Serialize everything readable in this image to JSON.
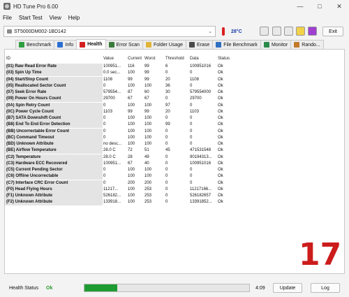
{
  "window": {
    "title": "HD Tune Pro 6.00",
    "minimize_icon": "minimize-icon",
    "maximize_icon": "maximize-icon",
    "close_icon": "close-icon"
  },
  "menu": [
    "File",
    "Start Test",
    "View",
    "Help"
  ],
  "toolbar": {
    "drive": "ST5000DM002-1BD142",
    "temperature": "28°C",
    "exit_label": "Exit",
    "icons": [
      "copy-text-icon",
      "copy-screenshot-icon",
      "save-icon",
      "options-icon",
      "download-icon"
    ]
  },
  "tabs": [
    {
      "label": "Benchmark",
      "icon": "benchmark-icon",
      "color": "#2f9e3f"
    },
    {
      "label": "Info",
      "icon": "info-icon",
      "color": "#2a6fd0"
    },
    {
      "label": "Health",
      "icon": "health-cross-icon",
      "color": "#d21f1f",
      "active": true
    },
    {
      "label": "Error Scan",
      "icon": "magnifier-icon",
      "color": "#3a7a3a"
    },
    {
      "label": "Folder Usage",
      "icon": "folder-icon",
      "color": "#e0b43a"
    },
    {
      "label": "Erase",
      "icon": "erase-icon",
      "color": "#4a4a4a"
    },
    {
      "label": "File Benchmark",
      "icon": "file-benchmark-icon",
      "color": "#2f6fc0"
    },
    {
      "label": "Monitor",
      "icon": "monitor-icon",
      "color": "#2a8a4a"
    },
    {
      "label": "Rando...",
      "icon": "random-access-icon",
      "color": "#c07a2a"
    }
  ],
  "table": {
    "headers": {
      "id": "ID",
      "value": "Value",
      "current": "Current",
      "worst": "Worst",
      "threshold": "Threshold",
      "data": "Data",
      "status": "Status"
    },
    "rows": [
      {
        "id": "(01) Raw Read Error Rate",
        "value": "100951...",
        "current": "116",
        "worst": "99",
        "threshold": "6",
        "data": "100951016",
        "status": "Ok"
      },
      {
        "id": "(03) Spin Up Time",
        "value": "0.0 sec...",
        "current": "100",
        "worst": "99",
        "threshold": "0",
        "data": "0",
        "status": "Ok"
      },
      {
        "id": "(04) Start/Stop Count",
        "value": "1108",
        "current": "99",
        "worst": "99",
        "threshold": "20",
        "data": "1108",
        "status": "Ok"
      },
      {
        "id": "(05) Reallocated Sector Count",
        "value": "0",
        "current": "100",
        "worst": "100",
        "threshold": "36",
        "data": "0",
        "status": "Ok"
      },
      {
        "id": "(07) Seek Error Rate",
        "value": "579554...",
        "current": "87",
        "worst": "60",
        "threshold": "30",
        "data": "579554000",
        "status": "Ok"
      },
      {
        "id": "(09) Power On Hours Count",
        "value": "29700",
        "current": "67",
        "worst": "67",
        "threshold": "0",
        "data": "29700",
        "status": "Ok"
      },
      {
        "id": "(0A) Spin Retry Count",
        "value": "0",
        "current": "100",
        "worst": "100",
        "threshold": "97",
        "data": "0",
        "status": "Ok"
      },
      {
        "id": "(0C) Power Cycle Count",
        "value": "1103",
        "current": "99",
        "worst": "99",
        "threshold": "20",
        "data": "1103",
        "status": "Ok"
      },
      {
        "id": "(B7) SATA Downshift Count",
        "value": "0",
        "current": "100",
        "worst": "100",
        "threshold": "0",
        "data": "0",
        "status": "Ok"
      },
      {
        "id": "(B8) End To End Error Detection",
        "value": "0",
        "current": "100",
        "worst": "100",
        "threshold": "99",
        "data": "0",
        "status": "Ok"
      },
      {
        "id": "(BB) Uncorrectable Error Count",
        "value": "0",
        "current": "100",
        "worst": "100",
        "threshold": "0",
        "data": "0",
        "status": "Ok"
      },
      {
        "id": "(BC) Command Timeout",
        "value": "0",
        "current": "100",
        "worst": "100",
        "threshold": "0",
        "data": "0",
        "status": "Ok"
      },
      {
        "id": "(BD) Unknown Attribute",
        "value": "no desc...",
        "current": "100",
        "worst": "100",
        "threshold": "0",
        "data": "0",
        "status": "Ok"
      },
      {
        "id": "(BE) Airflow Temperature",
        "value": "28.0 C",
        "current": "72",
        "worst": "51",
        "threshold": "45",
        "data": "471531548",
        "status": "Ok"
      },
      {
        "id": "(C2) Temperature",
        "value": "28.0 C",
        "current": "28",
        "worst": "49",
        "threshold": "0",
        "data": "90194313...",
        "status": "Ok"
      },
      {
        "id": "(C3) Hardware ECC Recovered",
        "value": "100951...",
        "current": "67",
        "worst": "40",
        "threshold": "0",
        "data": "100951016",
        "status": "Ok"
      },
      {
        "id": "(C5) Current Pending Sector",
        "value": "0",
        "current": "100",
        "worst": "100",
        "threshold": "0",
        "data": "0",
        "status": "Ok"
      },
      {
        "id": "(C6) Offline Uncorrectable",
        "value": "0",
        "current": "100",
        "worst": "100",
        "threshold": "0",
        "data": "0",
        "status": "Ok"
      },
      {
        "id": "(C7) Interface CRC Error Count",
        "value": "0",
        "current": "200",
        "worst": "200",
        "threshold": "0",
        "data": "0",
        "status": "Ok"
      },
      {
        "id": "(F0) Head Flying Hours",
        "value": "11217...",
        "current": "100",
        "worst": "253",
        "threshold": "0",
        "data": "11217166...",
        "status": "Ok"
      },
      {
        "id": "(F1) Unknown Attribute",
        "value": "526182...",
        "current": "100",
        "worst": "253",
        "threshold": "0",
        "data": "526182657",
        "status": "Ok"
      },
      {
        "id": "(F2) Unknown Attribute",
        "value": "133918...",
        "current": "100",
        "worst": "253",
        "threshold": "0",
        "data": "13391852...",
        "status": "Ok"
      }
    ]
  },
  "overlay_number": "17",
  "statusbar": {
    "health_label": "Health Status",
    "health_value": "Ok",
    "progress_fraction": 0.2,
    "time": "4:09",
    "update_label": "Update",
    "log_label": "Log"
  },
  "colors": {
    "health_ok": "#2b9a2b",
    "progress": "#1e9c32",
    "overlay_number": "#cc1c1c",
    "temperature": "#1a3aa8"
  }
}
